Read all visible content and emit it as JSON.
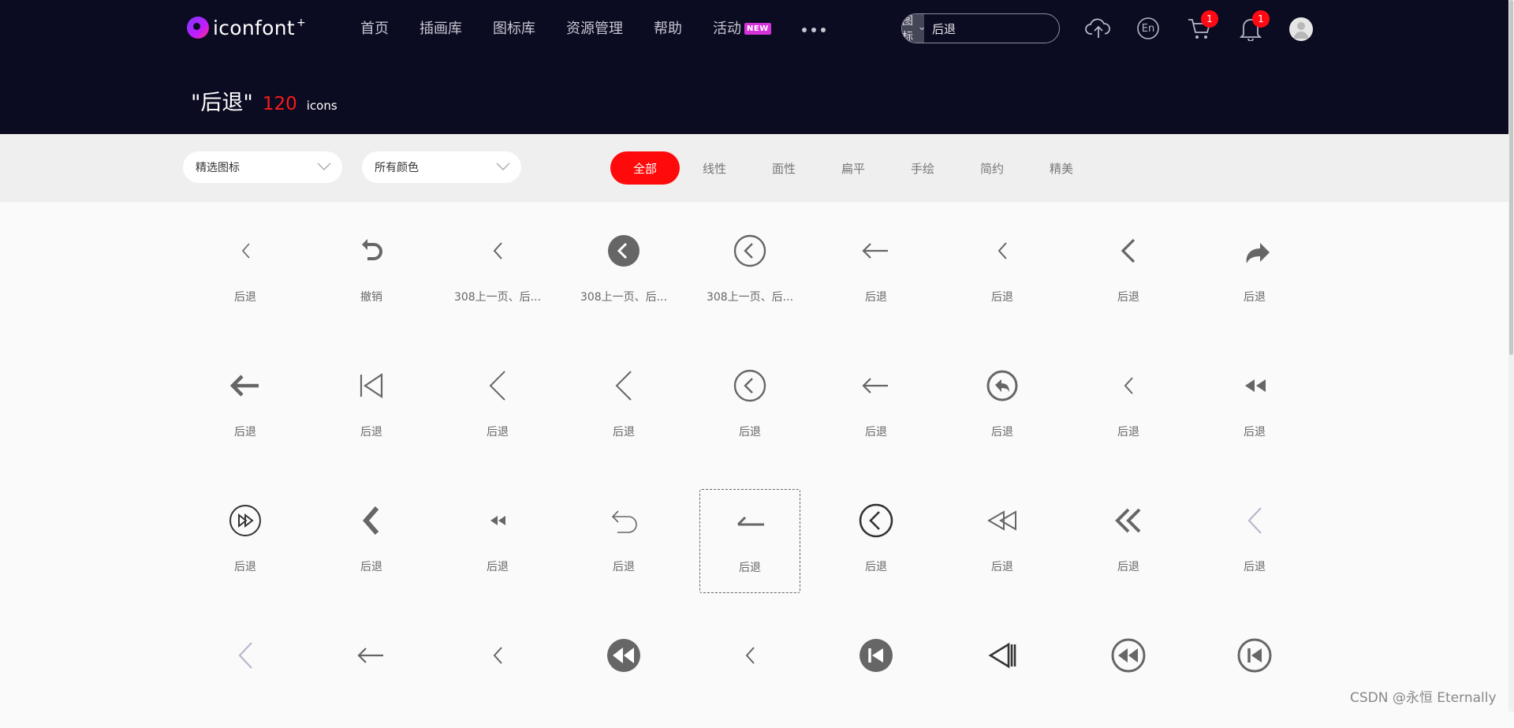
{
  "brand": {
    "name": "iconfont",
    "plus": "+"
  },
  "nav": {
    "items": [
      "首页",
      "插画库",
      "图标库",
      "资源管理",
      "帮助",
      "活动"
    ],
    "new_badge": "NEW"
  },
  "search": {
    "type": "图标",
    "value": "后退"
  },
  "header_badges": {
    "cart": "1",
    "bell": "1"
  },
  "lang_label": "En",
  "result": {
    "query": "\"后退\"",
    "count": "120",
    "unit": "icons"
  },
  "filters": {
    "select1": "精选图标",
    "select2": "所有颜色",
    "tags": [
      "全部",
      "线性",
      "面性",
      "扁平",
      "手绘",
      "简约",
      "精美"
    ],
    "active_tag": "全部"
  },
  "icons": [
    {
      "label": "后退",
      "icon": "chevron-left-thin-icon"
    },
    {
      "label": "撤销",
      "icon": "undo-arrow-icon"
    },
    {
      "label": "308上一页、后...",
      "icon": "chevron-left-icon"
    },
    {
      "label": "308上一页、后...",
      "icon": "chevron-left-circle-filled-icon"
    },
    {
      "label": "308上一页、后...",
      "icon": "chevron-left-circle-outline-icon"
    },
    {
      "label": "后退",
      "icon": "arrow-left-icon"
    },
    {
      "label": "后退",
      "icon": "chevron-left-icon"
    },
    {
      "label": "后退",
      "icon": "chevron-left-bold-icon"
    },
    {
      "label": "后退",
      "icon": "redo-curved-icon"
    },
    {
      "label": "后退",
      "icon": "arrow-left-bold-icon"
    },
    {
      "label": "后退",
      "icon": "skip-back-bar-icon"
    },
    {
      "label": "后退",
      "icon": "chevron-left-large-icon"
    },
    {
      "label": "后退",
      "icon": "chevron-left-large-icon"
    },
    {
      "label": "后退",
      "icon": "chevron-left-circle-outline-icon"
    },
    {
      "label": "后退",
      "icon": "arrow-left-icon"
    },
    {
      "label": "后退",
      "icon": "reply-circle-icon"
    },
    {
      "label": "后退",
      "icon": "chevron-left-icon"
    },
    {
      "label": "后退",
      "icon": "rewind-icon"
    },
    {
      "label": "后退",
      "icon": "fast-forward-circle-icon"
    },
    {
      "label": "后退",
      "icon": "chevron-left-heavy-icon"
    },
    {
      "label": "后退",
      "icon": "rewind-small-icon"
    },
    {
      "label": "后退",
      "icon": "return-arrow-icon"
    },
    {
      "label": "后退",
      "icon": "half-arrow-left-icon"
    },
    {
      "label": "后退",
      "icon": "chevron-left-circle-black-icon"
    },
    {
      "label": "后退",
      "icon": "rewind-outline-icon"
    },
    {
      "label": "后退",
      "icon": "double-chevron-left-icon"
    },
    {
      "label": "后退",
      "icon": "chevron-left-light-icon"
    },
    {
      "label": "",
      "icon": "chevron-left-light-icon"
    },
    {
      "label": "",
      "icon": "arrow-left-icon"
    },
    {
      "label": "",
      "icon": "chevron-left-icon"
    },
    {
      "label": "",
      "icon": "rewind-circle-filled-icon"
    },
    {
      "label": "",
      "icon": "chevron-left-icon"
    },
    {
      "label": "",
      "icon": "skip-back-circle-filled-icon"
    },
    {
      "label": "",
      "icon": "play-back-outline-icon"
    },
    {
      "label": "",
      "icon": "rewind-circle-outline-icon"
    },
    {
      "label": "",
      "icon": "skip-back-circle-outline-icon"
    }
  ],
  "selected_index": 22,
  "watermark": "CSDN @永恒 Eternally"
}
